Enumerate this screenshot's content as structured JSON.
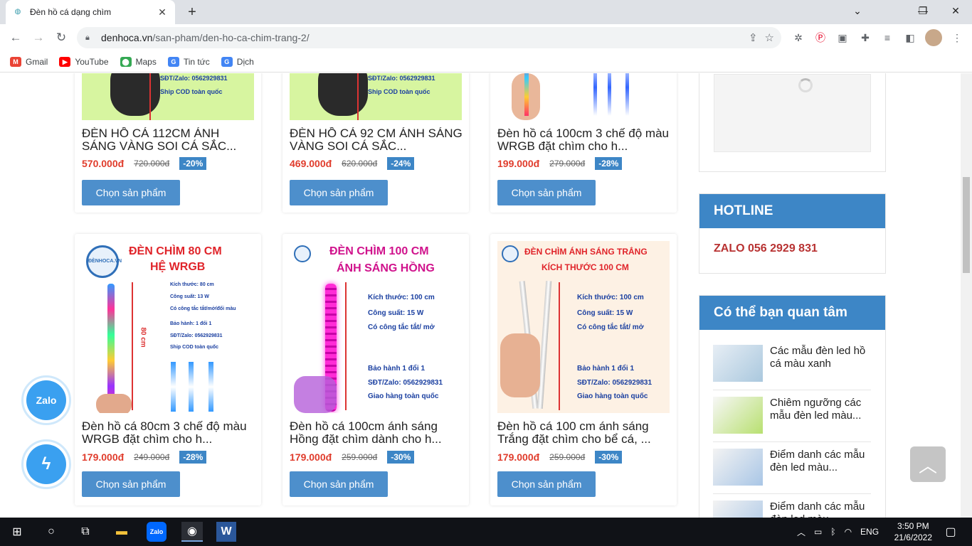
{
  "browser": {
    "tab_title": "Đèn hồ cá dạng chìm",
    "url_host": "denhoca.vn",
    "url_path": "/san-pham/den-ho-ca-chim-trang-2/",
    "bookmarks": [
      {
        "label": "Gmail",
        "icon": "gmail-icon",
        "color": "#ea4335"
      },
      {
        "label": "YouTube",
        "icon": "youtube-icon",
        "color": "#ff0000"
      },
      {
        "label": "Maps",
        "icon": "maps-icon",
        "color": "#34a853"
      },
      {
        "label": "Tin tức",
        "icon": "news-icon",
        "color": "#4285f4"
      },
      {
        "label": "Dịch",
        "icon": "translate-icon",
        "color": "#4285f4"
      }
    ]
  },
  "products_row1": [
    {
      "name": "ĐÈN HỒ CÁ 112CM ÁNH SÁNG VÀNG SOI CÁ SẮC...",
      "price": "570.000đ",
      "old": "720.000đ",
      "badge": "-20%",
      "img_lines": [
        "SĐT/Zalo: 0562929831",
        "Ship COD toàn quốc"
      ]
    },
    {
      "name": "ĐÈN HỒ CÁ 92 CM ÁNH SÁNG VÀNG SOI CÁ SẮC...",
      "price": "469.000đ",
      "old": "620.000đ",
      "badge": "-24%",
      "img_lines": [
        "SĐT/Zalo: 0562929831",
        "Ship COD toàn quốc"
      ]
    },
    {
      "name": "Đèn hồ cá 100cm 3 chế độ màu WRGB đặt chìm cho h...",
      "price": "199.000đ",
      "old": "279.000đ",
      "badge": "-28%",
      "img_lines": []
    }
  ],
  "products_row2": [
    {
      "name": "Đèn hồ cá 80cm 3 chế độ màu WRGB đặt chìm cho h...",
      "price": "179.000đ",
      "old": "249.000đ",
      "badge": "-28%",
      "img_title1": "ĐÈN CHÌM 80 CM",
      "img_title2": "HỆ WRGB",
      "img_lines": [
        "Kích thước: 80 cm",
        "Công suất: 13 W",
        "Có công tắc tắt/mở/đổi màu",
        "Bảo hành: 1 đổi 1",
        "SĐT/Zalo: 0562929831",
        "Ship COD toàn quốc"
      ],
      "bg": "#ffffff"
    },
    {
      "name": "Đèn hồ cá 100cm ánh sáng Hồng đặt chìm dành cho h...",
      "price": "179.000đ",
      "old": "259.000đ",
      "badge": "-30%",
      "img_title1": "ĐÈN CHÌM 100 CM",
      "img_title2": "ÁNH SÁNG HỒNG",
      "img_lines": [
        "Kích thước: 100 cm",
        "Công suất: 15 W",
        "Có công tắc tắt/ mở",
        "Bảo hành 1 đổi 1",
        "SĐT/Zalo: 0562929831",
        "Giao hàng toàn quốc"
      ],
      "bg": "#ffffff"
    },
    {
      "name": "Đèn hồ cá 100 cm ánh sáng Trắng đặt chìm cho bể cá, ...",
      "price": "179.000đ",
      "old": "259.000đ",
      "badge": "-30%",
      "img_title1": "ĐÈN CHÌM ÁNH SÁNG TRẮNG",
      "img_title2": "KÍCH THƯỚC 100 CM",
      "img_lines": [
        "Kích thước: 100 cm",
        "Công suất: 15 W",
        "Có công tắc tắt/ mở",
        "Bảo hành 1 đổi 1",
        "SĐT/Zalo: 0562929831",
        "Giao hàng toàn quốc"
      ],
      "bg": "#fdf1e4"
    }
  ],
  "select_label": "Chọn sản phẩm",
  "sidebar": {
    "hotline_title": "HOTLINE",
    "hotline_text": "ZALO 056 2929 831",
    "related_title": "Có thể bạn quan tâm",
    "related": [
      "Các mẫu đèn led hồ cá màu xanh",
      "Chiêm ngưỡng các mẫu đèn led màu...",
      "Điểm danh các mẫu đèn led màu...",
      "Điểm danh các mẫu đèn led màu..."
    ]
  },
  "floating": {
    "zalo": "Zalo"
  },
  "taskbar": {
    "lang": "ENG",
    "time": "3:50 PM",
    "date": "21/6/2022"
  }
}
